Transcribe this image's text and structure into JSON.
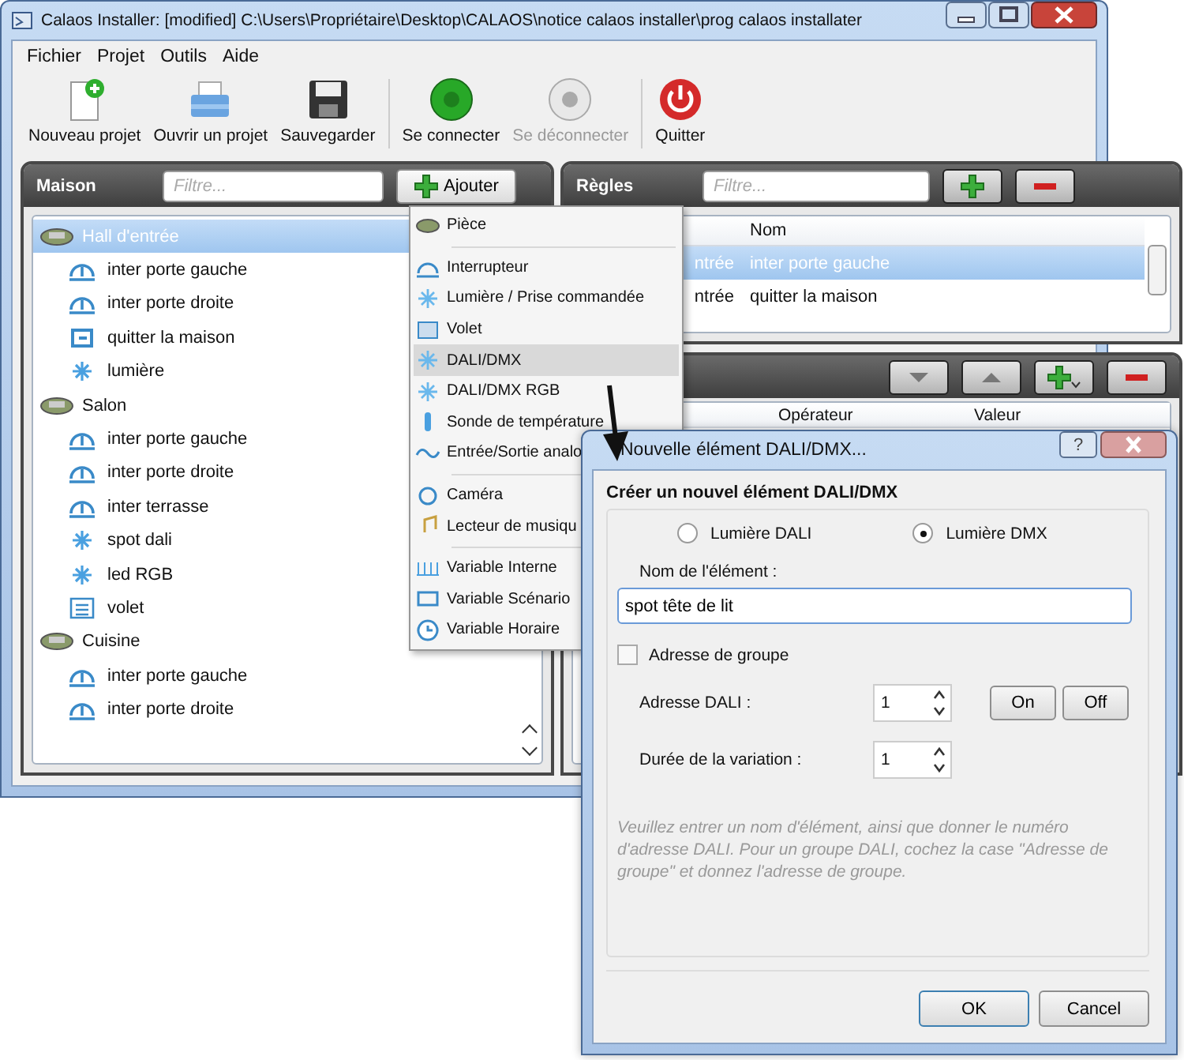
{
  "window": {
    "title": "Calaos Installer: [modified] C:\\Users\\Propriétaire\\Desktop\\CALAOS\\notice calaos installer\\prog calaos installater"
  },
  "menu_bar": [
    "Fichier",
    "Projet",
    "Outils",
    "Aide"
  ],
  "toolbar": [
    {
      "kind": "new",
      "label": "Nouveau projet",
      "disabled": false
    },
    {
      "kind": "open",
      "label": "Ouvrir un projet",
      "disabled": false
    },
    {
      "kind": "save",
      "label": "Sauvegarder",
      "disabled": false
    },
    {
      "kind": "connect",
      "label": "Se connecter",
      "disabled": false
    },
    {
      "kind": "disconnect",
      "label": "Se déconnecter",
      "disabled": true
    },
    {
      "kind": "quit",
      "label": "Quitter",
      "disabled": false
    }
  ],
  "maison_panel": {
    "title": "Maison",
    "filter_placeholder": "Filtre...",
    "add_button": "Ajouter",
    "tree": [
      {
        "kind": "room",
        "label": "Hall d'entrée",
        "selected": true,
        "children": [
          {
            "kind": "switch",
            "label": "inter porte gauche",
            "selected": false
          },
          {
            "kind": "switch",
            "label": "inter porte droite",
            "selected": false
          },
          {
            "kind": "scenario",
            "label": "quitter la maison",
            "selected": false
          },
          {
            "kind": "light",
            "label": "lumière",
            "selected": false
          }
        ]
      },
      {
        "kind": "room",
        "label": "Salon",
        "selected": false,
        "children": [
          {
            "kind": "switch",
            "label": "inter porte gauche",
            "selected": false
          },
          {
            "kind": "switch",
            "label": "inter porte droite",
            "selected": false
          },
          {
            "kind": "switch",
            "label": "inter terrasse",
            "selected": false
          },
          {
            "kind": "light",
            "label": "spot dali",
            "selected": false
          },
          {
            "kind": "light",
            "label": "led RGB",
            "selected": false
          },
          {
            "kind": "shutter",
            "label": "volet",
            "selected": false
          }
        ]
      },
      {
        "kind": "room",
        "label": "Cuisine",
        "selected": false,
        "children": [
          {
            "kind": "switch",
            "label": "inter porte gauche",
            "selected": false
          },
          {
            "kind": "switch",
            "label": "inter porte droite",
            "selected": false
          }
        ]
      }
    ]
  },
  "regles_panel": {
    "title": "Règles",
    "filter_placeholder": "Filtre...",
    "name_column": "Nom",
    "rows": [
      {
        "column_1": "ntrée",
        "nom": "inter porte gauche",
        "selected": true
      },
      {
        "column_1": "ntrée",
        "nom": "quitter la maison",
        "selected": false
      }
    ]
  },
  "conditions_panel": {
    "columns": [
      "Opérateur",
      "Valeur"
    ]
  },
  "add_menu": [
    [
      {
        "kind": "room",
        "label": "Pièce",
        "selected": false
      }
    ],
    [
      {
        "kind": "switch",
        "label": "Interrupteur",
        "selected": false
      },
      {
        "kind": "light",
        "label": "Lumière / Prise commandée",
        "selected": false
      },
      {
        "kind": "shutter",
        "label": "Volet",
        "selected": false
      },
      {
        "kind": "light",
        "label": "DALI/DMX",
        "selected": true
      },
      {
        "kind": "light",
        "label": "DALI/DMX RGB",
        "selected": false
      },
      {
        "kind": "temperature",
        "label": "Sonde de température",
        "selected": false
      },
      {
        "kind": "analog",
        "label": "Entrée/Sortie analo",
        "selected": false
      }
    ],
    [
      {
        "kind": "camera",
        "label": "Caméra",
        "selected": false
      },
      {
        "kind": "music",
        "label": "Lecteur de musiqu",
        "selected": false
      }
    ],
    [
      {
        "kind": "variable",
        "label": "Variable Interne",
        "selected": false
      },
      {
        "kind": "scenario",
        "label": "Variable Scénario",
        "selected": false
      },
      {
        "kind": "clock",
        "label": "Variable Horaire",
        "selected": false
      }
    ]
  ],
  "dialog": {
    "title": "Nouvelle élément DALI/DMX...",
    "help_button": "?",
    "heading": "Créer un nouvel élément DALI/DMX",
    "radios": [
      {
        "label": "Lumière DALI",
        "selected": false
      },
      {
        "label": "Lumière DMX",
        "selected": true
      }
    ],
    "name_label": "Nom de l'élément :",
    "name_value": "spot tête de lit",
    "group_checkbox": {
      "label": "Adresse de groupe",
      "checked": false
    },
    "address": {
      "label": "Adresse DALI :",
      "value": "1"
    },
    "on_button": "On",
    "off_button": "Off",
    "duration": {
      "label": "Durée de la variation :",
      "value": "1"
    },
    "help": "Veuillez entrer un nom d'élément, ainsi que donner le numéro d'adresse DALI. Pour un groupe DALI, cochez la case \"Adresse de groupe\" et donnez l'adresse de groupe.",
    "ok": "OK",
    "cancel": "Cancel"
  }
}
